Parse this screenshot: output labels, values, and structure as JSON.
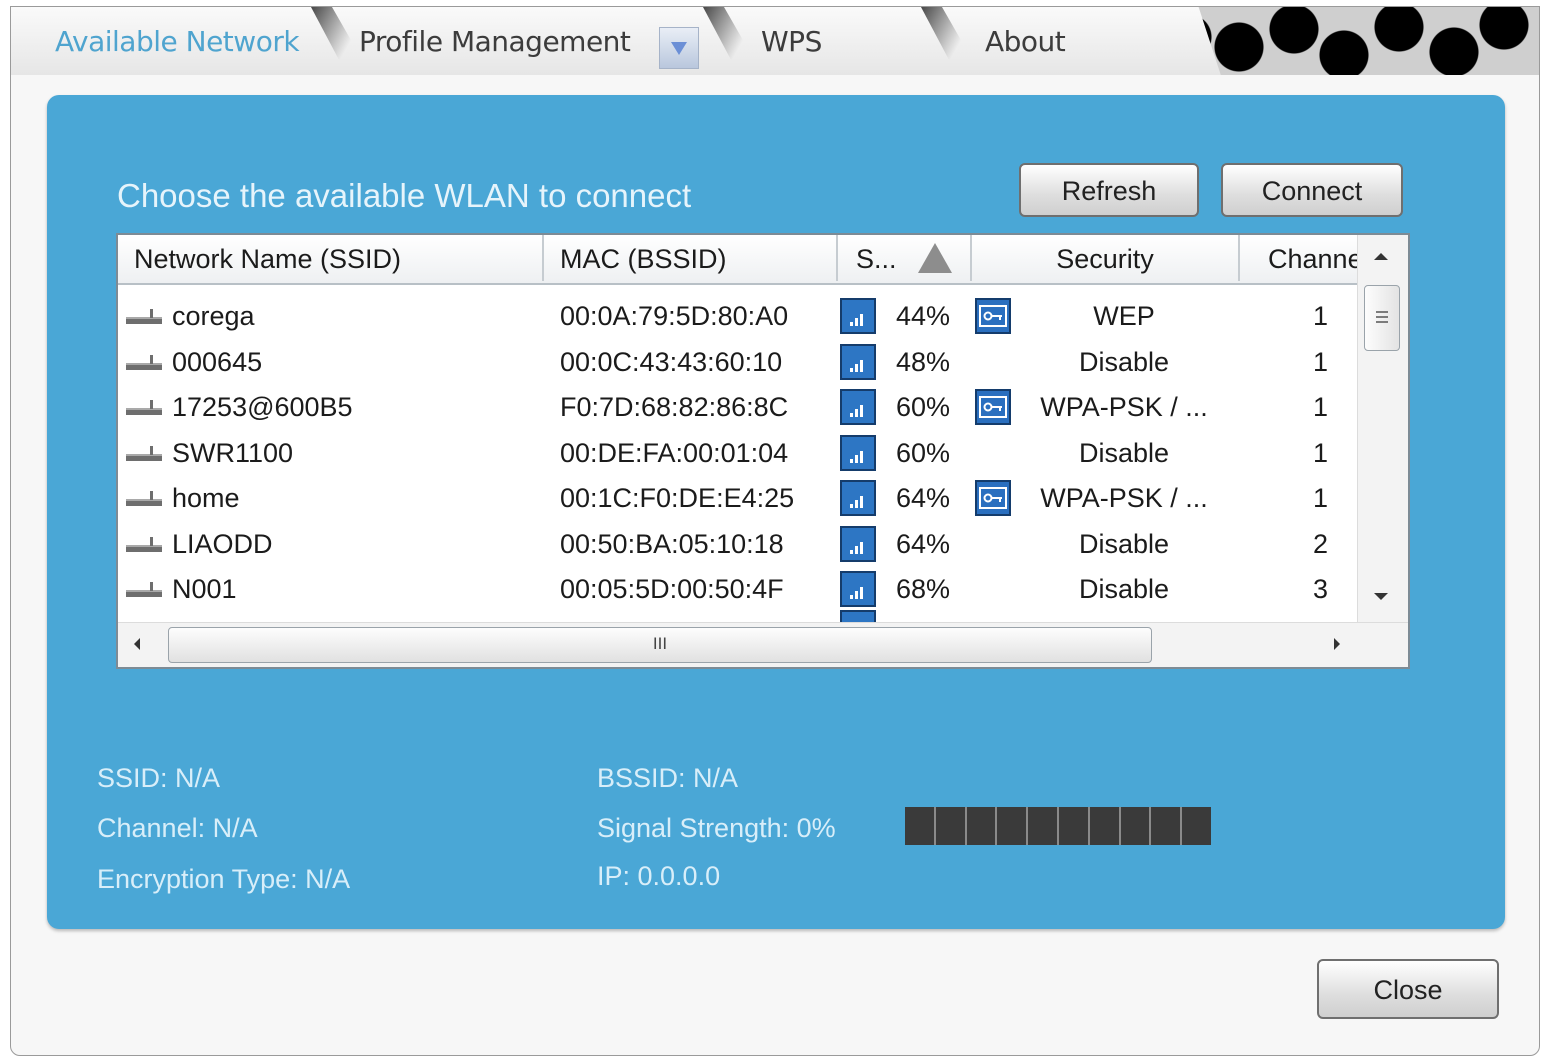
{
  "tabs": [
    {
      "label": "Available Network",
      "active": true
    },
    {
      "label": "Profile Management",
      "active": false
    },
    {
      "label": "WPS",
      "active": false
    },
    {
      "label": "About",
      "active": false
    }
  ],
  "panel": {
    "title": "Choose the available WLAN to connect",
    "refresh_label": "Refresh",
    "connect_label": "Connect"
  },
  "table": {
    "columns": [
      "Network Name (SSID)",
      "MAC (BSSID)",
      "S...",
      "Security",
      "Channe"
    ],
    "sort_column": "S...",
    "rows": [
      {
        "ssid": "corega",
        "mac": "00:0A:79:5D:80:A0",
        "signal": "44%",
        "secured": true,
        "security": "WEP",
        "channel": "1"
      },
      {
        "ssid": "000645",
        "mac": "00:0C:43:43:60:10",
        "signal": "48%",
        "secured": false,
        "security": "Disable",
        "channel": "1"
      },
      {
        "ssid": "17253@600B5",
        "mac": "F0:7D:68:82:86:8C",
        "signal": "60%",
        "secured": true,
        "security": "WPA-PSK / ...",
        "channel": "1"
      },
      {
        "ssid": "SWR1100",
        "mac": "00:DE:FA:00:01:04",
        "signal": "60%",
        "secured": false,
        "security": "Disable",
        "channel": "1"
      },
      {
        "ssid": "home",
        "mac": "00:1C:F0:DE:E4:25",
        "signal": "64%",
        "secured": true,
        "security": "WPA-PSK / ...",
        "channel": "1"
      },
      {
        "ssid": "LIAODD",
        "mac": "00:50:BA:05:10:18",
        "signal": "64%",
        "secured": false,
        "security": "Disable",
        "channel": "2"
      },
      {
        "ssid": "N001",
        "mac": "00:05:5D:00:50:4F",
        "signal": "68%",
        "secured": false,
        "security": "Disable",
        "channel": "3"
      }
    ],
    "hscroll_grip": "III"
  },
  "status": {
    "ssid": "SSID: N/A",
    "channel": "Channel: N/A",
    "encryption": "Encryption Type: N/A",
    "bssid": "BSSID: N/A",
    "signal": "Signal Strength: 0%",
    "ip": "IP: 0.0.0.0",
    "signal_level": 0
  },
  "close_label": "Close",
  "icons": {
    "network": "network-icon",
    "signal": "signal-strength-icon",
    "security": "lock-key-icon"
  },
  "colors": {
    "panel": "#4aa7d6",
    "active_tab": "#4fa4cf",
    "signal_icon": "#2d76c4"
  }
}
